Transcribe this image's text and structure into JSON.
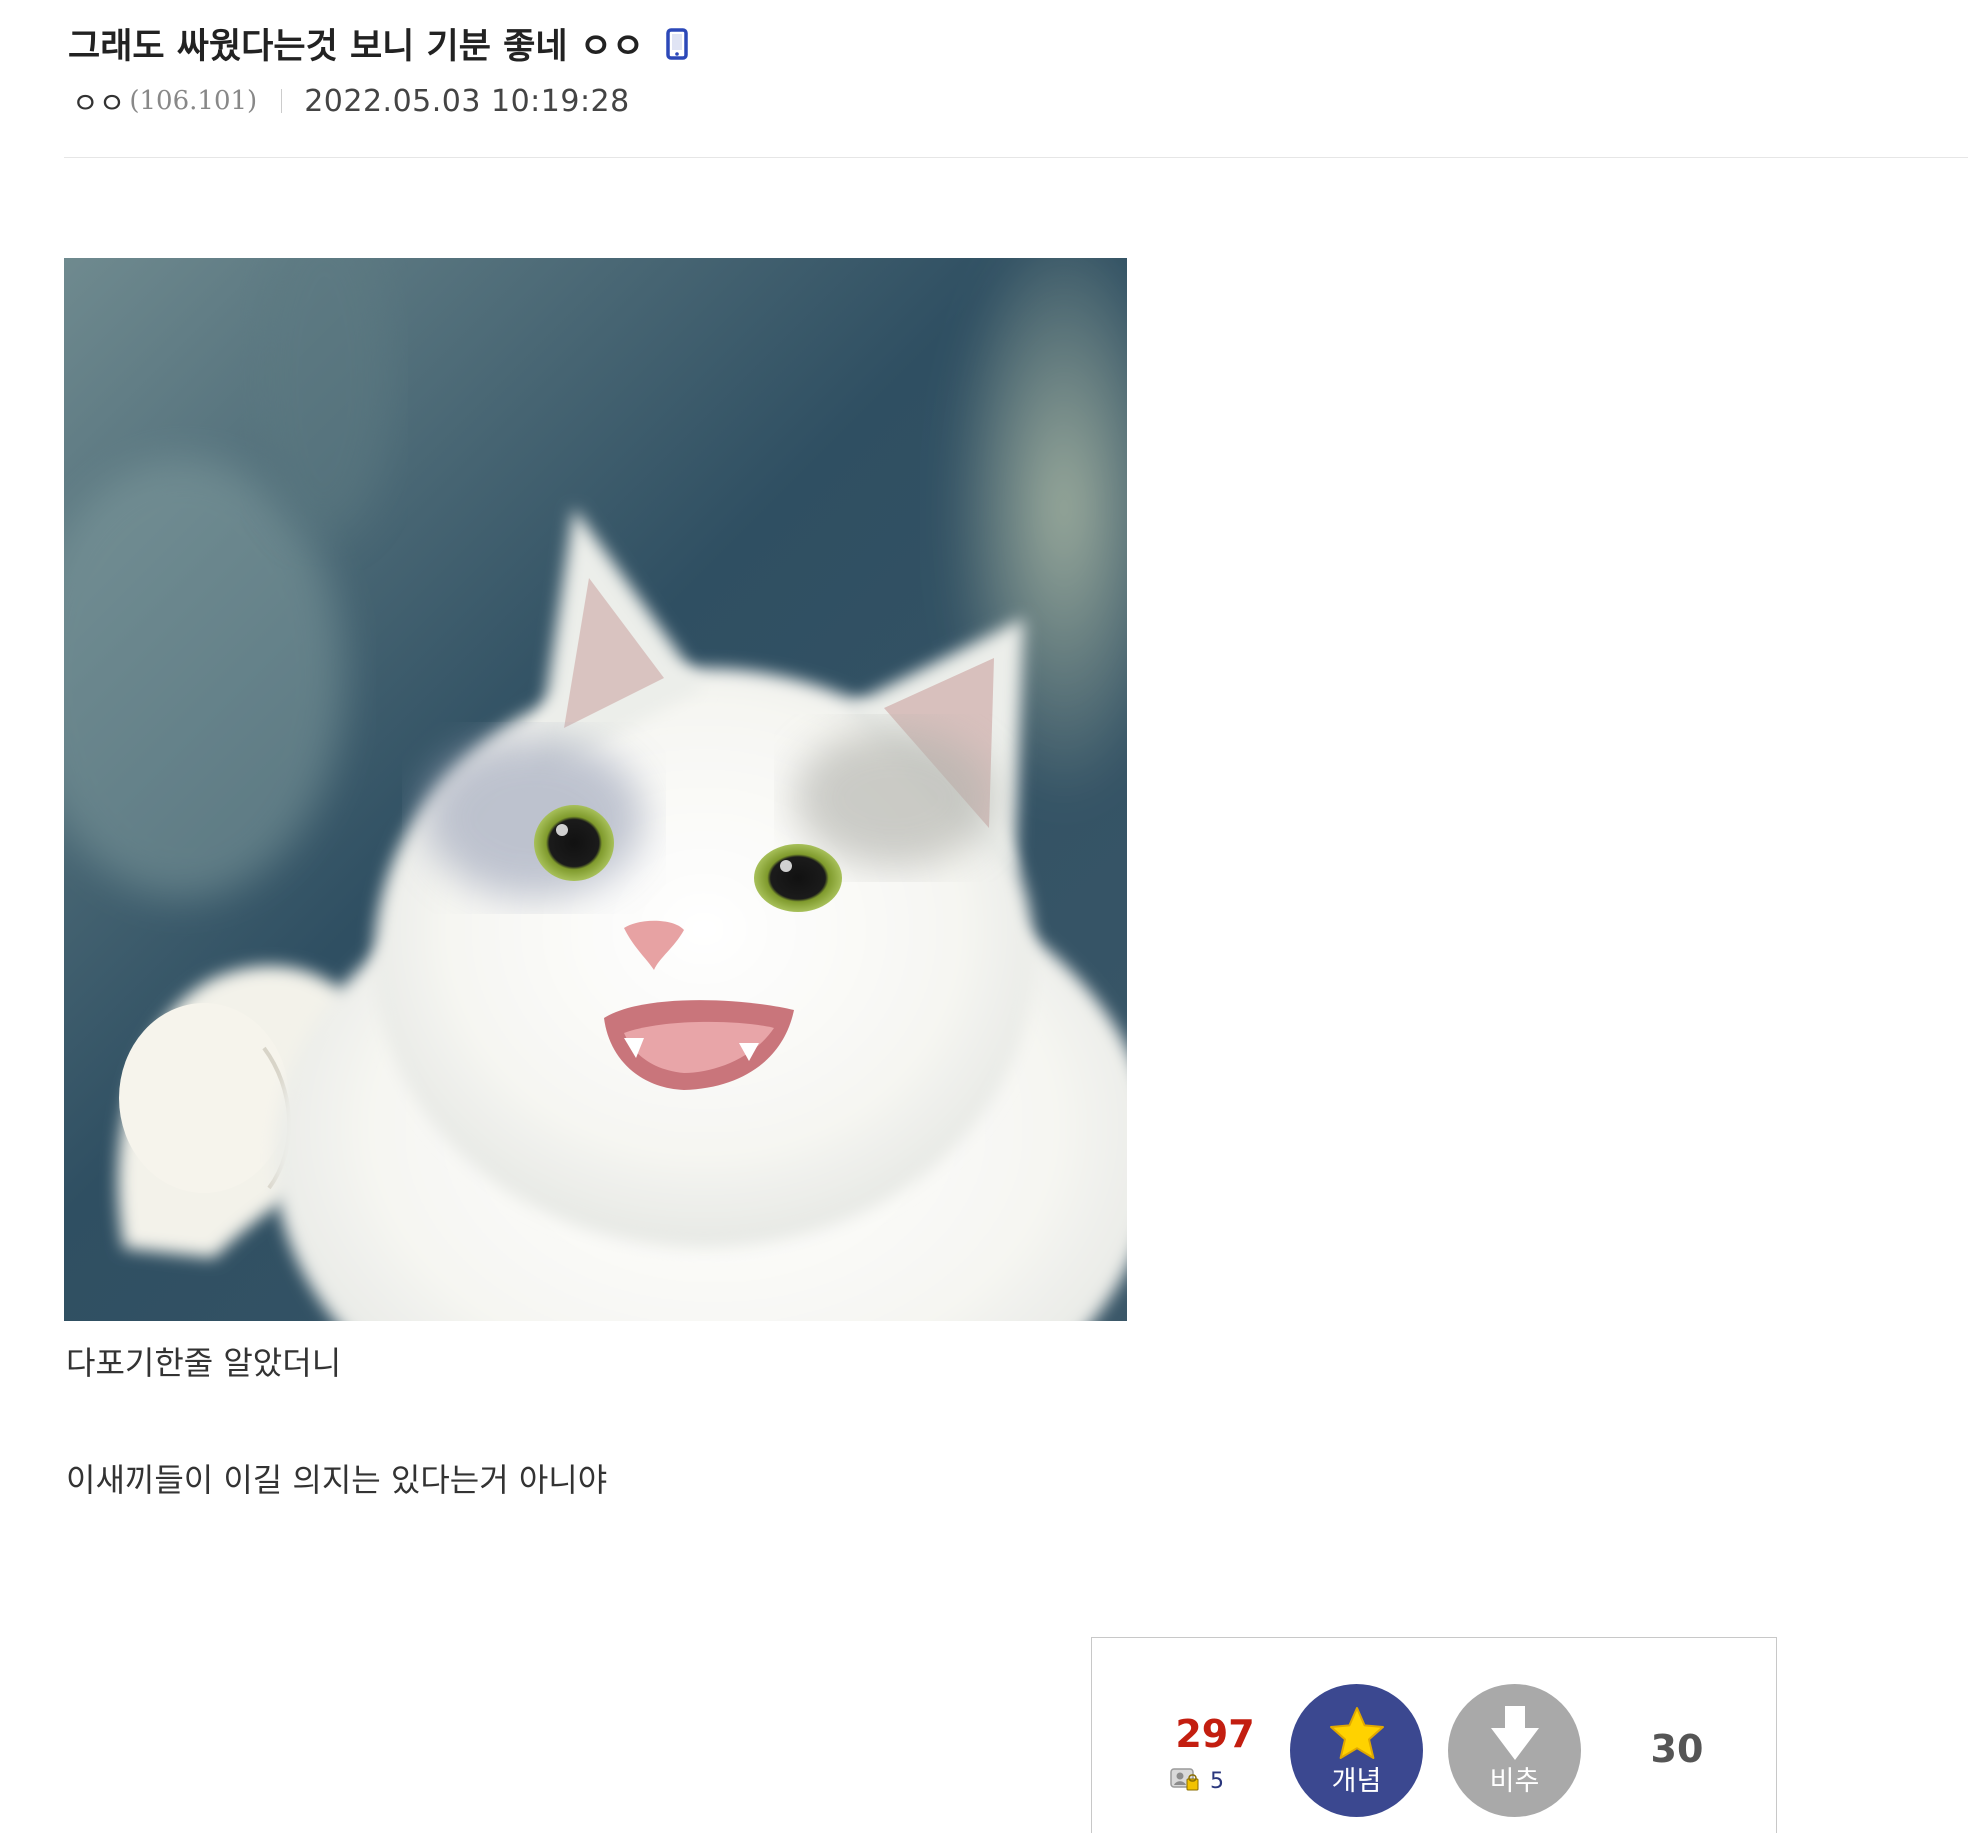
{
  "post": {
    "title": "그래도 싸웠다는것 보니 기분 좋네 ㅇㅇ",
    "writer_nick": "ㅇㅇ",
    "writer_ip": "(106.101)",
    "date": "2022.05.03 10:19:28",
    "body_lines": [
      "다포기한줄 알았더니",
      "이새끼들이 이길 의지는 있다는거 아니야"
    ],
    "image_alt": "cat-meme"
  },
  "recommend": {
    "up_count": "297",
    "fix_count": "5",
    "up_label": "개념",
    "down_label": "비추",
    "down_count": "30"
  },
  "icons": {
    "title_icon": "mobile-icon",
    "fix_icon": "fixed-user-icon",
    "up_icon": "star-icon",
    "down_icon": "down-arrow-icon"
  },
  "colors": {
    "up_count": "#c31e10",
    "up_button": "#3b4890",
    "down_button": "#a9a9a9",
    "mobile_icon": "#2c48b8"
  }
}
